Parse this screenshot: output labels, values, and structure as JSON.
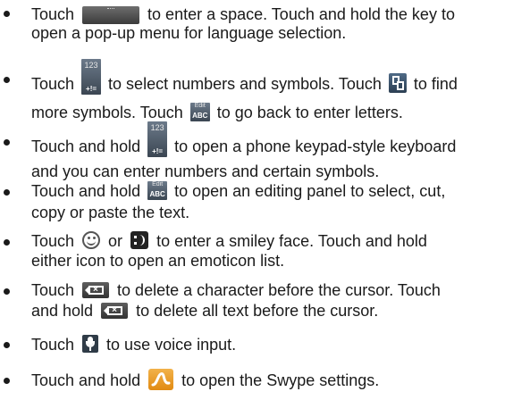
{
  "items": [
    {
      "l1a": "Touch",
      "l1b": "to enter a space. Touch and hold the key to",
      "l2": "open a pop-up menu for language selection."
    },
    {
      "l1a": "Touch",
      "l1b": "to select numbers and symbols. Touch",
      "l1c": "to find",
      "l2a": "more symbols. Touch",
      "l2b": "to go back to enter letters."
    },
    {
      "l1a": "Touch and hold",
      "l1b": "to open a phone keypad-style keyboard",
      "l2": "and you can enter numbers and certain symbols."
    },
    {
      "l1a": "Touch and hold",
      "l1b": "to open an editing panel to select, cut,",
      "l2": "copy or paste the text."
    },
    {
      "l1a": "Touch",
      "l1b": "or",
      "l1c": "to enter a smiley face. Touch and hold",
      "l2": "either icon to open an emoticon list."
    },
    {
      "l1a": "Touch",
      "l1b": "to delete a character before the cursor. Touch",
      "l2a": "and hold",
      "l2b": "to delete all text before the cursor."
    },
    {
      "l1a": "Touch",
      "l1b": "to use voice input."
    },
    {
      "l1a": "Touch and hold",
      "l1b": "to open the Swype settings."
    }
  ],
  "keys": {
    "numbers_top": "123",
    "numbers_bottom": "+!=",
    "edit_top": "Edit",
    "edit_bottom": "ABC"
  },
  "icons": {
    "space": "space-key-icon",
    "numbers": "numbers-symbols-key-icon",
    "more_symbols": "more-symbols-key-icon",
    "edit": "edit-abc-key-icon",
    "smiley": "smiley-icon",
    "emoticon": "emoticon-key-icon",
    "delete": "delete-key-icon",
    "voice": "microphone-icon",
    "swype": "swype-logo-icon"
  },
  "colors": {
    "text": "#1a1a1a",
    "key_dark": "#3b3b3b",
    "swype_orange": "#e8961f"
  }
}
